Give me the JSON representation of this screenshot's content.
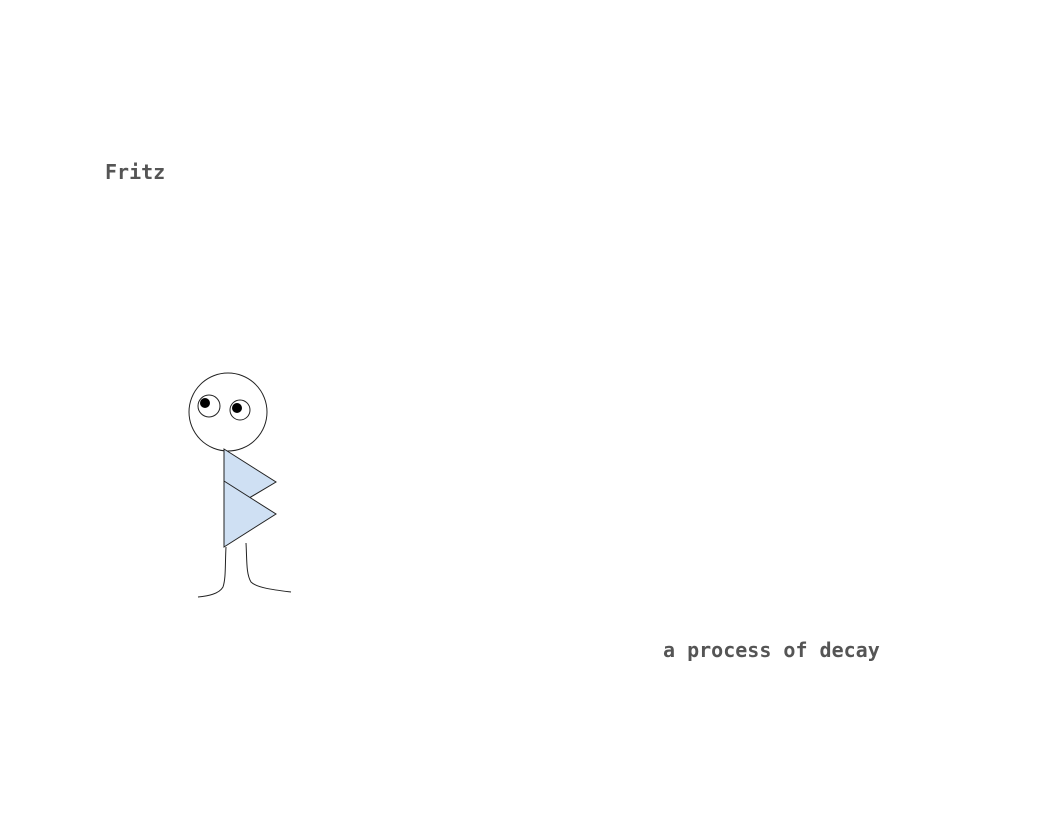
{
  "title": "Fritz",
  "caption": "a process of decay",
  "figure": {
    "icon": "stick-figure-icon",
    "body_color": "#cfe0f3",
    "line_color": "#222222"
  }
}
